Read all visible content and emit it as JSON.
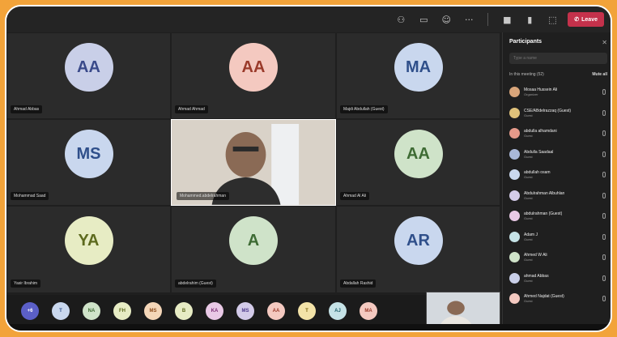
{
  "topbar": {
    "leave_label": "Leave"
  },
  "tiles": [
    {
      "initials": "AA",
      "name": "Ahmad Abbas",
      "color": "#c9cfe8",
      "text": "#3a4a8a"
    },
    {
      "initials": "AA",
      "name": "Ahmad Ahmad",
      "color": "#f4c9c0",
      "text": "#9a3a2a"
    },
    {
      "initials": "MA",
      "name": "Majdi Abdullah (Guest)",
      "color": "#c9d7ee",
      "text": "#2f4f8a"
    },
    {
      "initials": "MS",
      "name": "Mohammad Saad",
      "color": "#c9d7ee",
      "text": "#2f4f8a"
    },
    {
      "initials": "AA",
      "name": "Ahmad Al Ali",
      "color": "#cfe3c9",
      "text": "#3e6b34"
    },
    {
      "initials": "YA",
      "name": "Yasir Ibrahim",
      "color": "#e7ecc4",
      "text": "#5d6a1e"
    },
    {
      "initials": "A",
      "name": "abdelrahim (Guest)",
      "color": "#cfe3c9",
      "text": "#3e6b34"
    },
    {
      "initials": "AR",
      "name": "Abdallah Rashid",
      "color": "#c9d7ee",
      "text": "#2f4f8a"
    }
  ],
  "video_tile": {
    "name": "Mohammed.abdelrahman"
  },
  "strip": [
    {
      "label": "+6",
      "bg": "#5b5fc7",
      "fg": "#ffffff"
    },
    {
      "label": "T",
      "bg": "#c9d7ee",
      "fg": "#2f4f8a"
    },
    {
      "label": "NA",
      "bg": "#cfe3c9",
      "fg": "#3e6b34"
    },
    {
      "label": "FH",
      "bg": "#e7ecc4",
      "fg": "#5d6a1e"
    },
    {
      "label": "MS",
      "bg": "#f4d6b8",
      "fg": "#8a4a1a"
    },
    {
      "label": "B",
      "bg": "#e7ecc4",
      "fg": "#5d6a1e"
    },
    {
      "label": "KA",
      "bg": "#e9c9e6",
      "fg": "#7a2d74"
    },
    {
      "label": "MS",
      "bg": "#d3cbe9",
      "fg": "#4d3a8a"
    },
    {
      "label": "AA",
      "bg": "#f4c9c0",
      "fg": "#9a3a2a"
    },
    {
      "label": "T",
      "bg": "#f3e3a8",
      "fg": "#7a6410"
    },
    {
      "label": "AJ",
      "bg": "#c5e2e6",
      "fg": "#1f5f6a"
    },
    {
      "label": "MA",
      "bg": "#f4c9c0",
      "fg": "#9a3a2a"
    }
  ],
  "panel": {
    "title": "Participants",
    "search_placeholder": "Type a name",
    "section_label": "In this meeting (52)",
    "mute_all": "Mute all",
    "people": [
      {
        "name": "Mosaa Hussein Ali",
        "role": "Organizer"
      },
      {
        "name": "CSE/ABdelrazzaq (Guest)",
        "role": "Guest"
      },
      {
        "name": "abdulla alhamdani",
        "role": "Guest"
      },
      {
        "name": "Abdulla Saadaal",
        "role": "Guest"
      },
      {
        "name": "abdullah osam",
        "role": "Guest"
      },
      {
        "name": "Abdulrahman Albuhlan",
        "role": "Guest"
      },
      {
        "name": "abdulrahman (Guest)",
        "role": "Guest"
      },
      {
        "name": "Adam J",
        "role": "Guest"
      },
      {
        "name": "Ahmed W Ali",
        "role": "Guest"
      },
      {
        "name": "ahmad Abbas",
        "role": "Guest"
      },
      {
        "name": "Ahmed Najdat (Guest)",
        "role": "Guest"
      }
    ]
  }
}
